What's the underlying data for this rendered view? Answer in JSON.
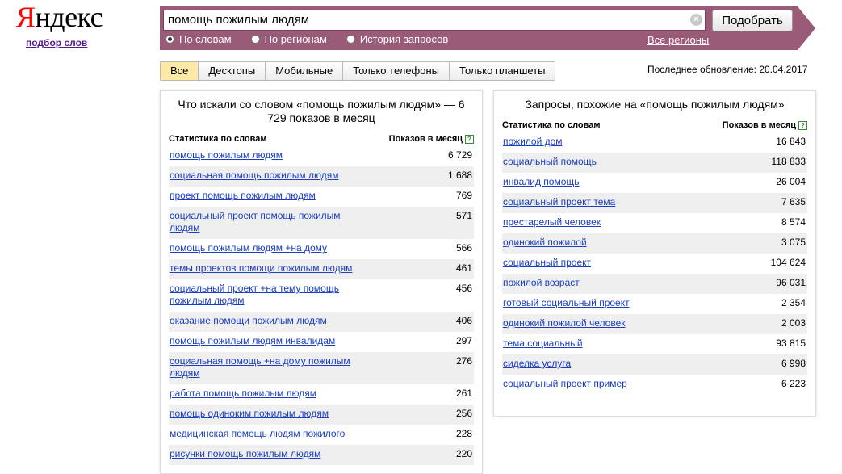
{
  "logo": {
    "ya": "Я",
    "rest": "ндекс",
    "sub": "подбор слов"
  },
  "search": {
    "query": "помощь пожилым людям",
    "button": "Подобрать"
  },
  "radios": [
    {
      "label": "По словам",
      "checked": true
    },
    {
      "label": "По регионам",
      "checked": false
    },
    {
      "label": "История запросов",
      "checked": false
    }
  ],
  "regions_link": "Все регионы",
  "tabs": [
    "Все",
    "Десктопы",
    "Мобильные",
    "Только телефоны",
    "Только планшеты"
  ],
  "updated": "Последнее обновление: 20.04.2017",
  "left": {
    "title": "Что искали со словом «помощь пожилым людям» — 6 729 показов в месяц",
    "col_words": "Статистика по словам",
    "col_count": "Показов в месяц",
    "rows": [
      {
        "phrase": "помощь пожилым людям",
        "count": "6 729"
      },
      {
        "phrase": "социальная помощь пожилым людям",
        "count": "1 688"
      },
      {
        "phrase": "проект помощь пожилым людям",
        "count": "769"
      },
      {
        "phrase": "социальный проект помощь пожилым людям",
        "count": "571"
      },
      {
        "phrase": "помощь пожилым людям +на дому",
        "count": "566"
      },
      {
        "phrase": "темы проектов помощи пожилым людям",
        "count": "461"
      },
      {
        "phrase": "социальный проект +на тему помощь пожилым людям",
        "count": "456"
      },
      {
        "phrase": "оказание помощи пожилым людям",
        "count": "406"
      },
      {
        "phrase": "помощь пожилым людям инвалидам",
        "count": "297"
      },
      {
        "phrase": "социальная помощь +на дому пожилым людям",
        "count": "276"
      },
      {
        "phrase": "работа помощь пожилым людям",
        "count": "261"
      },
      {
        "phrase": "помощь одиноким пожилым людям",
        "count": "256"
      },
      {
        "phrase": "медицинская помощь людям пожилого",
        "count": "228"
      },
      {
        "phrase": "рисунки помощь пожилым людям",
        "count": "220"
      }
    ]
  },
  "right": {
    "title": "Запросы, похожие на «помощь пожилым людям»",
    "col_words": "Статистика по словам",
    "col_count": "Показов в месяц",
    "rows": [
      {
        "phrase": "пожилой дом",
        "count": "16 843"
      },
      {
        "phrase": "социальный помощь",
        "count": "118 833"
      },
      {
        "phrase": "инвалид помощь",
        "count": "26 004"
      },
      {
        "phrase": "социальный проект тема",
        "count": "7 635"
      },
      {
        "phrase": "престарелый человек",
        "count": "8 574"
      },
      {
        "phrase": "одинокий пожилой",
        "count": "3 075"
      },
      {
        "phrase": "социальный проект",
        "count": "104 624"
      },
      {
        "phrase": "пожилой возраст",
        "count": "96 031"
      },
      {
        "phrase": "готовый социальный проект",
        "count": "2 354"
      },
      {
        "phrase": "одинокий пожилой человек",
        "count": "2 003"
      },
      {
        "phrase": "тема социальный",
        "count": "93 815"
      },
      {
        "phrase": "сиделка услуга",
        "count": "6 998"
      },
      {
        "phrase": "социальный проект пример",
        "count": "6 223"
      }
    ]
  }
}
